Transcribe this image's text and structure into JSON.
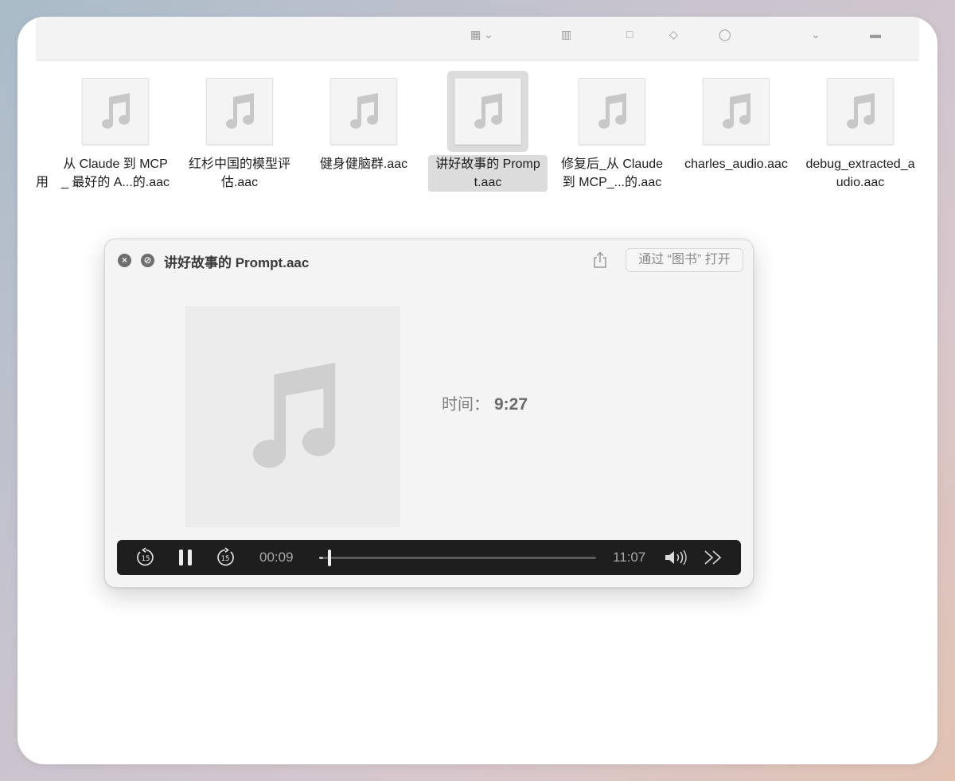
{
  "files": [
    {
      "name": "从 Claude 到 MCP_ 最好的 A...的.aac",
      "selected": false
    },
    {
      "name": "红杉中国的模型评估.aac",
      "selected": false
    },
    {
      "name": "健身健脑群.aac",
      "selected": false
    },
    {
      "name": "讲好故事的 Prompt.aac",
      "selected": true
    },
    {
      "name": "修复后_从 Claude 到 MCP_...的.aac",
      "selected": false
    },
    {
      "name": "charles_audio.aac",
      "selected": false
    },
    {
      "name": "debug_extracted_audio.aac",
      "selected": false
    }
  ],
  "cut_off_label": "用",
  "quicklook": {
    "title": "讲好故事的 Prompt.aac",
    "open_with": "通过 “图书” 打开",
    "duration_label": "时间：",
    "duration_value": "9:27",
    "player": {
      "current_time": "00:09",
      "total_time": "11:07",
      "progress_fraction": 0.013,
      "icons": [
        "skip-back-15-icon",
        "pause-icon",
        "skip-forward-15-icon",
        "volume-icon",
        "fast-forward-icon"
      ]
    }
  },
  "colors": {
    "selection": "#dcdcdc",
    "player_bar": "#1e1e1e"
  }
}
